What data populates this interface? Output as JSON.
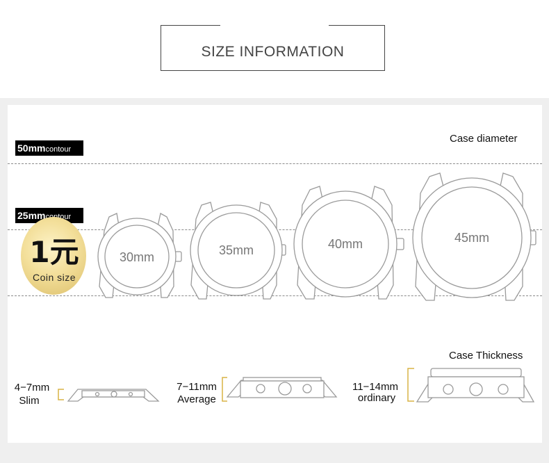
{
  "header": {
    "title": "SIZE INFORMATION"
  },
  "labels": {
    "contour_50": {
      "num": "50mm",
      "word": "contour"
    },
    "contour_25": {
      "num": "25mm",
      "word": "contour"
    },
    "case_diameter": "Case diameter",
    "case_thickness": "Case Thickness"
  },
  "coin": {
    "glyph": "1元",
    "caption": "Coin size"
  },
  "watches": [
    {
      "size": "30mm"
    },
    {
      "size": "35mm"
    },
    {
      "size": "40mm"
    },
    {
      "size": "45mm"
    }
  ],
  "thickness": [
    {
      "range": "4−7mm",
      "type": "Slim"
    },
    {
      "range": "7−11mm",
      "type": "Average"
    },
    {
      "range": "11−14mm",
      "type": "ordinary"
    }
  ],
  "colors": {
    "outline": "#9a9a9a",
    "bracket": "#d9b445",
    "coin": "#f0dc98"
  }
}
